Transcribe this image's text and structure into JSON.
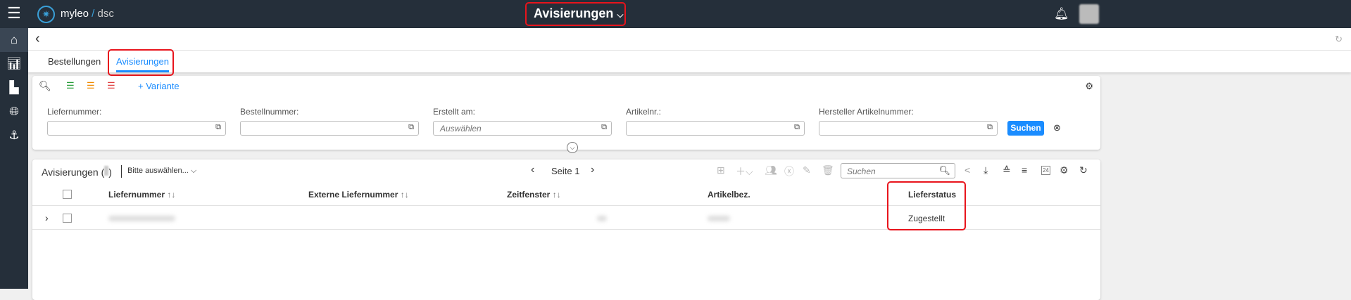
{
  "header": {
    "brand": "myleo",
    "brand_suffix": "dsc",
    "title": "Avisierungen"
  },
  "tabs": [
    {
      "label": "Bestellungen"
    },
    {
      "label": "Avisierungen",
      "active": true
    }
  ],
  "filter": {
    "variant_label": "+ Variante",
    "fields": [
      {
        "label": "Liefernummer:",
        "value": ""
      },
      {
        "label": "Bestellnummer:",
        "value": ""
      },
      {
        "label": "Erstellt am:",
        "placeholder": "Auswählen"
      },
      {
        "label": "Artikelnr.:",
        "value": ""
      },
      {
        "label": "Hersteller Artikelnummer:",
        "value": ""
      }
    ],
    "search_button": "Suchen"
  },
  "table": {
    "title": "Avisierungen (",
    "title_close": ")",
    "variant_select": "Bitte auswählen...",
    "page_label": "Seite 1",
    "search_placeholder": "Suchen",
    "calendar_day": "24",
    "columns": [
      "Liefernummer",
      "Externe Liefernummer",
      "Zeitfenster",
      "Artikelbez.",
      "Lieferstatus"
    ],
    "rows": [
      {
        "status": "Zugestellt"
      }
    ]
  },
  "colors": {
    "accent": "#1a8cff",
    "topbar": "#252f3a",
    "highlight": "#e8141c"
  }
}
